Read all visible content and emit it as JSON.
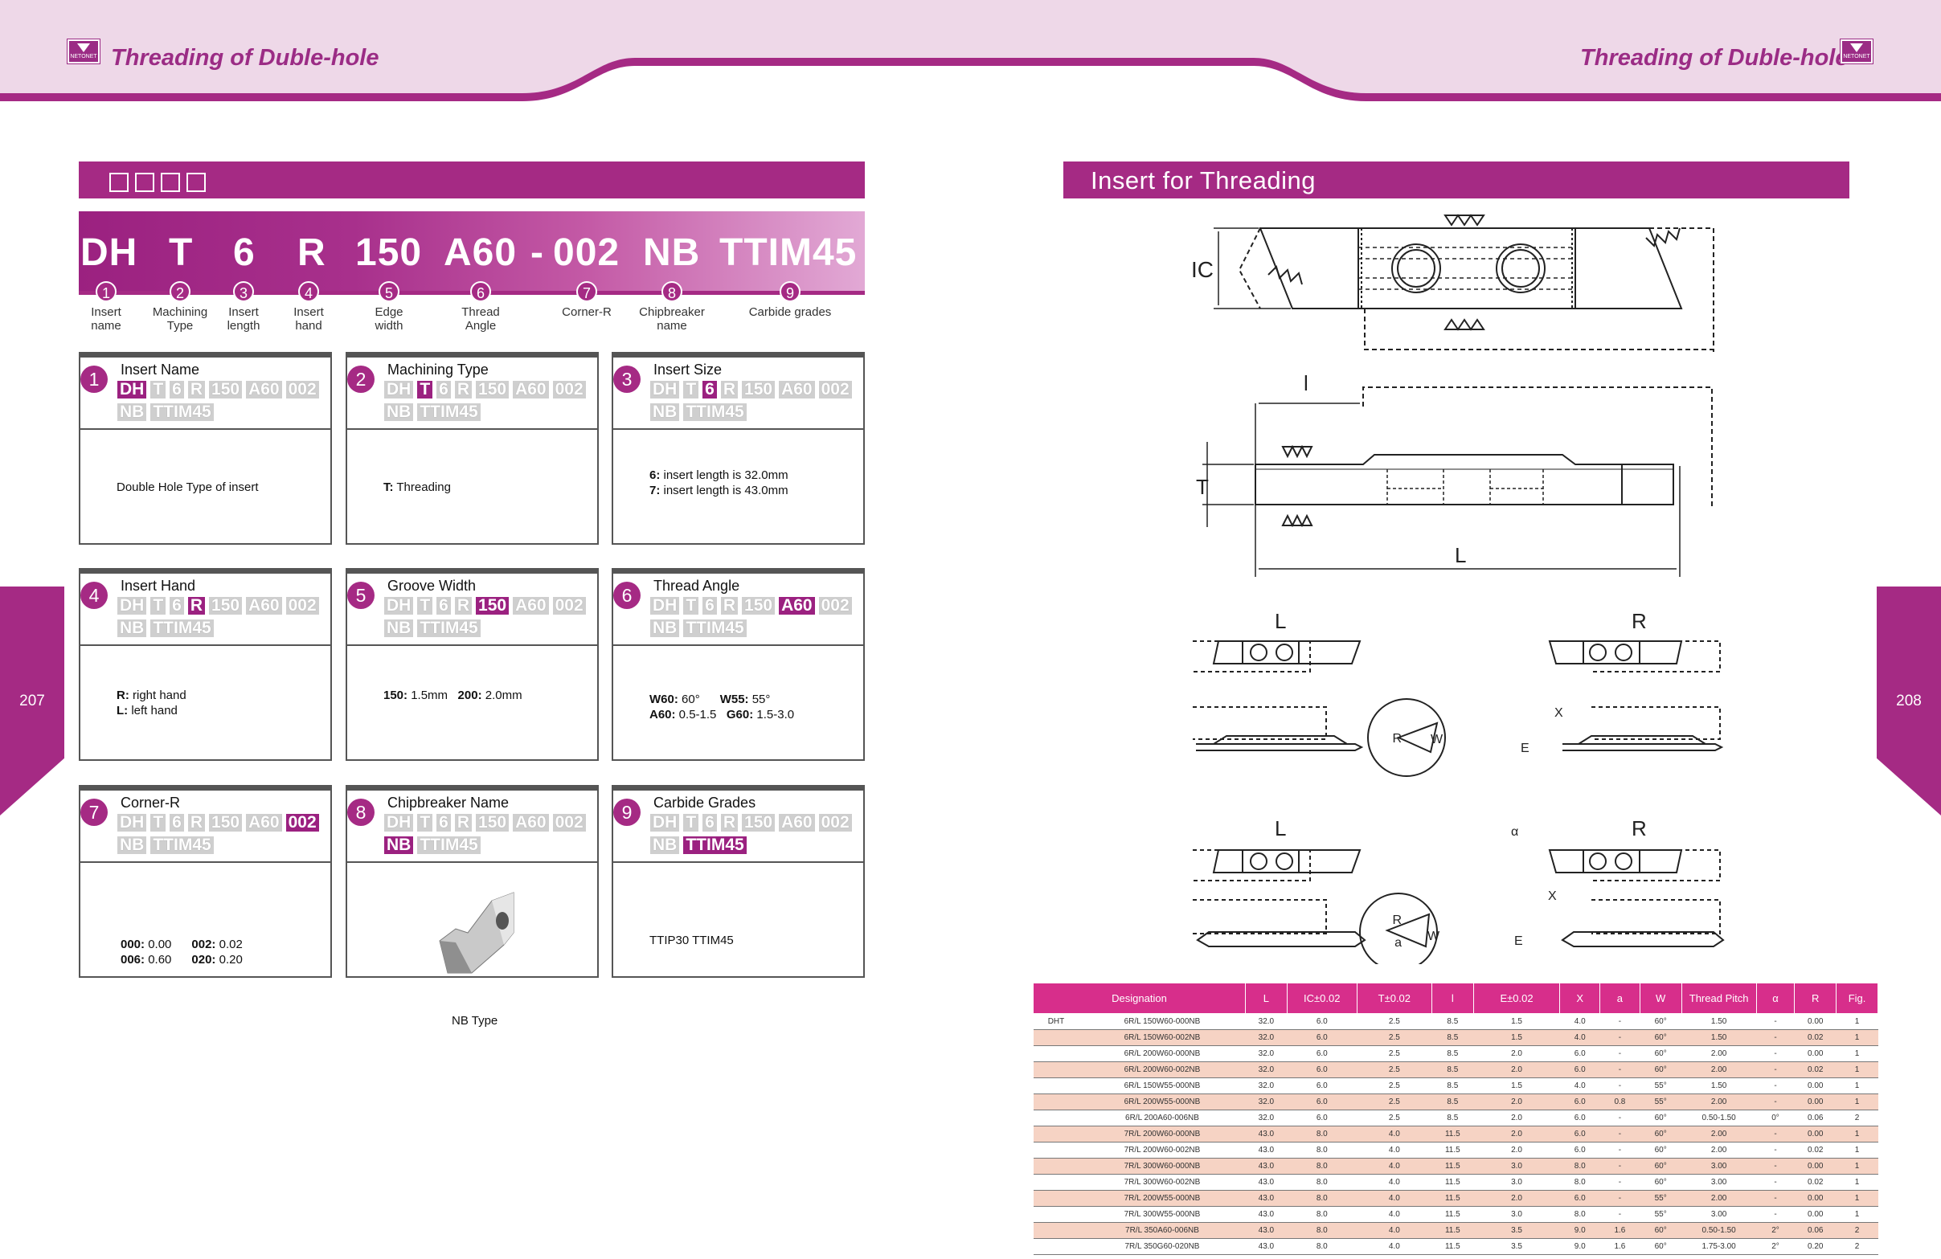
{
  "header": {
    "title_left": "Threading of Duble-hole",
    "title_right": "Threading of Duble-hole",
    "logo_text": "NETONET"
  },
  "page_left": "207",
  "page_right": "208",
  "left_section_title": "□□□□",
  "right_section_title": "Insert for Threading",
  "code": {
    "parts": [
      "DH",
      "T",
      "6",
      "R",
      "150",
      "A60",
      "-",
      "002",
      "NB",
      "TTIM45"
    ],
    "items": [
      {
        "n": "1",
        "label": "Insert\nname"
      },
      {
        "n": "2",
        "label": "Machining\nType"
      },
      {
        "n": "3",
        "label": "Insert\nlength"
      },
      {
        "n": "4",
        "label": "Insert\nhand"
      },
      {
        "n": "5",
        "label": "Edge\nwidth"
      },
      {
        "n": "6",
        "label": "Thread\nAngle"
      },
      {
        "n": "7",
        "label": "Corner-R"
      },
      {
        "n": "8",
        "label": "Chipbreaker\nname"
      },
      {
        "n": "9",
        "label": "Carbide grades"
      }
    ]
  },
  "chip_labels": [
    "DH",
    "T",
    "6",
    "R",
    "150",
    "A60",
    "002",
    "NB",
    "TTIM45"
  ],
  "cards": [
    {
      "n": "1",
      "title": "Insert Name",
      "hi": 0,
      "lines": [
        "Double Hole Type of insert"
      ]
    },
    {
      "n": "2",
      "title": "Machining Type",
      "hi": 1,
      "lines": [
        "T: Threading"
      ]
    },
    {
      "n": "3",
      "title": "Insert Size",
      "hi": 2,
      "lines": [
        "6: insert length is 32.0mm",
        "7: insert length is 43.0mm"
      ]
    },
    {
      "n": "4",
      "title": "Insert Hand",
      "hi": 3,
      "lines": [
        "R: right hand",
        "L: left hand"
      ]
    },
    {
      "n": "5",
      "title": "Groove Width",
      "hi": 4,
      "lines": [
        "150: 1.5mm   200: 2.0mm"
      ]
    },
    {
      "n": "6",
      "title": "Thread Angle",
      "hi": 5,
      "lines": [
        "W60: 60°      W55: 55°",
        "A60: 0.5-1.5   G60: 1.5-3.0"
      ]
    },
    {
      "n": "7",
      "title": "Corner-R",
      "hi": 6,
      "lines": [
        "000: 0.00      002: 0.02",
        "006: 0.60      020: 0.20"
      ]
    },
    {
      "n": "8",
      "title": "Chipbreaker Name",
      "hi": 7,
      "lines": [
        "NB Type"
      ]
    },
    {
      "n": "9",
      "title": "Carbide Grades",
      "hi": 8,
      "lines": [
        "TTIP30    TTIM45"
      ]
    }
  ],
  "card_bold": {
    "c3": [
      "6:",
      "7:"
    ],
    "c4": [
      "R:",
      "L:"
    ],
    "c5": [
      "150:",
      "200:"
    ],
    "c6": [
      "W60:",
      "W55:",
      "A60:",
      "G60:"
    ],
    "c7": [
      "000:",
      "002:",
      "006:",
      "020:"
    ],
    "c2": [
      "T:"
    ]
  },
  "drawing_labels": {
    "ic": "IC",
    "l": "l",
    "t": "T",
    "L": "L",
    "left": "L",
    "right": "R",
    "x": "X",
    "e": "E",
    "w": "W",
    "r": "R",
    "a": "a",
    "alpha": "α"
  },
  "table": {
    "headers": [
      "Designation",
      "",
      "L",
      "IC±0.02",
      "T±0.02",
      "l",
      "E±0.02",
      "X",
      "a",
      "W",
      "Thread Pitch",
      "α",
      "R",
      "Fig."
    ],
    "rows": [
      [
        "DHT",
        "6R/L 150W60-000NB",
        "32.0",
        "6.0",
        "2.5",
        "8.5",
        "1.5",
        "4.0",
        "-",
        "60°",
        "1.50",
        "-",
        "0.00",
        "1"
      ],
      [
        "",
        "6R/L 150W60-002NB",
        "32.0",
        "6.0",
        "2.5",
        "8.5",
        "1.5",
        "4.0",
        "-",
        "60°",
        "1.50",
        "-",
        "0.02",
        "1"
      ],
      [
        "",
        "6R/L 200W60-000NB",
        "32.0",
        "6.0",
        "2.5",
        "8.5",
        "2.0",
        "6.0",
        "-",
        "60°",
        "2.00",
        "-",
        "0.00",
        "1"
      ],
      [
        "",
        "6R/L 200W60-002NB",
        "32.0",
        "6.0",
        "2.5",
        "8.5",
        "2.0",
        "6.0",
        "-",
        "60°",
        "2.00",
        "-",
        "0.02",
        "1"
      ],
      [
        "",
        "6R/L 150W55-000NB",
        "32.0",
        "6.0",
        "2.5",
        "8.5",
        "1.5",
        "4.0",
        "-",
        "55°",
        "1.50",
        "-",
        "0.00",
        "1"
      ],
      [
        "",
        "6R/L 200W55-000NB",
        "32.0",
        "6.0",
        "2.5",
        "8.5",
        "2.0",
        "6.0",
        "0.8",
        "55°",
        "2.00",
        "-",
        "0.00",
        "1"
      ],
      [
        "",
        "6R/L 200A60-006NB",
        "32.0",
        "6.0",
        "2.5",
        "8.5",
        "2.0",
        "6.0",
        "-",
        "60°",
        "0.50-1.50",
        "0°",
        "0.06",
        "2"
      ],
      [
        "",
        "7R/L 200W60-000NB",
        "43.0",
        "8.0",
        "4.0",
        "11.5",
        "2.0",
        "6.0",
        "-",
        "60°",
        "2.00",
        "-",
        "0.00",
        "1"
      ],
      [
        "",
        "7R/L 200W60-002NB",
        "43.0",
        "8.0",
        "4.0",
        "11.5",
        "2.0",
        "6.0",
        "-",
        "60°",
        "2.00",
        "-",
        "0.02",
        "1"
      ],
      [
        "",
        "7R/L 300W60-000NB",
        "43.0",
        "8.0",
        "4.0",
        "11.5",
        "3.0",
        "8.0",
        "-",
        "60°",
        "3.00",
        "-",
        "0.00",
        "1"
      ],
      [
        "",
        "7R/L 300W60-002NB",
        "43.0",
        "8.0",
        "4.0",
        "11.5",
        "3.0",
        "8.0",
        "-",
        "60°",
        "3.00",
        "-",
        "0.02",
        "1"
      ],
      [
        "",
        "7R/L 200W55-000NB",
        "43.0",
        "8.0",
        "4.0",
        "11.5",
        "2.0",
        "6.0",
        "-",
        "55°",
        "2.00",
        "-",
        "0.00",
        "1"
      ],
      [
        "",
        "7R/L 300W55-000NB",
        "43.0",
        "8.0",
        "4.0",
        "11.5",
        "3.0",
        "8.0",
        "-",
        "55°",
        "3.00",
        "-",
        "0.00",
        "1"
      ],
      [
        "",
        "7R/L 350A60-006NB",
        "43.0",
        "8.0",
        "4.0",
        "11.5",
        "3.5",
        "9.0",
        "1.6",
        "60°",
        "0.50-1.50",
        "2°",
        "0.06",
        "2"
      ],
      [
        "",
        "7R/L 350G60-020NB",
        "43.0",
        "8.0",
        "4.0",
        "11.5",
        "3.5",
        "9.0",
        "1.6",
        "60°",
        "1.75-3.00",
        "2°",
        "0.20",
        "2"
      ]
    ]
  }
}
